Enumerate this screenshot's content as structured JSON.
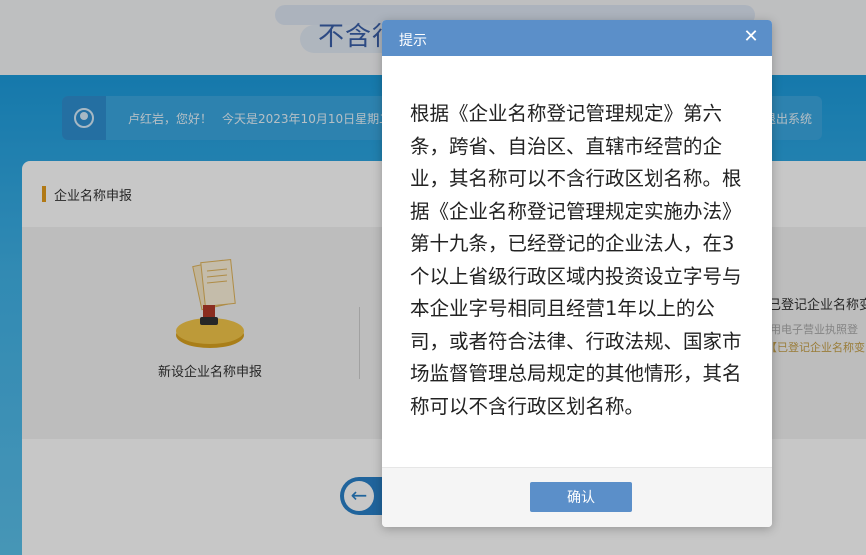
{
  "page": {
    "title": "不含行"
  },
  "user_bar": {
    "greeting": "卢红岩，您好！",
    "date_text": "今天是2023年10月10日星期二，",
    "logout": "退出系统"
  },
  "panel": {
    "section_title": "企业名称申报",
    "card_new": "新设企业名称申报",
    "card_registered": "已登记企业名称变",
    "card_registered_sub1": "用电子营业执照登",
    "card_registered_sub2": "【已登记企业名称变"
  },
  "modal": {
    "title": "提示",
    "close_icon": "close-icon",
    "body": "根据《企业名称登记管理规定》第六条，跨省、自治区、直辖市经营的企业，其名称可以不含行政区划名称。根据《企业名称登记管理规定实施办法》第十九条，已经登记的企业法人，在3个以上省级行政区域内投资设立字号与本企业字号相同且经营1年以上的公司，或者符合法律、行政法规、国家市场监督管理总局规定的其他情形，其名称可以不含行政区划名称。",
    "confirm": "确认"
  },
  "colors": {
    "header_blue": "#5b8fc9",
    "band_blue": "#1c9bdc",
    "accent_orange": "#e39b1c"
  }
}
